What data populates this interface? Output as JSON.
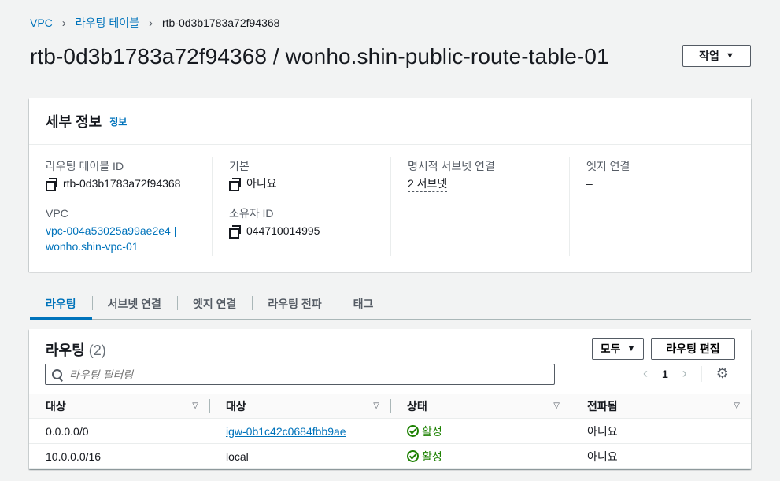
{
  "breadcrumb": {
    "items": [
      "VPC",
      "라우팅 테이블"
    ],
    "current": "rtb-0d3b1783a72f94368"
  },
  "page": {
    "title": "rtb-0d3b1783a72f94368 / wonho.shin-public-route-table-01",
    "action_label": "작업"
  },
  "details": {
    "heading": "세부 정보",
    "info_link": "정보",
    "route_table_id_label": "라우팅 테이블 ID",
    "route_table_id": "rtb-0d3b1783a72f94368",
    "vpc_label": "VPC",
    "vpc_value_1": "vpc-004a53025a99ae2e4 |",
    "vpc_value_2": "wonho.shin-vpc-01",
    "main_label": "기본",
    "main_value": "아니요",
    "owner_label": "소유자 ID",
    "owner_value": "044710014995",
    "explicit_subnet_label": "명시적 서브넷 연결",
    "explicit_subnet_value": "2 서브넷",
    "edge_label": "엣지 연결",
    "edge_value": "–"
  },
  "tabs": [
    "라우팅",
    "서브넷 연결",
    "엣지 연결",
    "라우팅 전파",
    "태그"
  ],
  "routes": {
    "heading": "라우팅",
    "count": "(2)",
    "filter_select": "모두",
    "edit_button": "라우팅 편집",
    "search_placeholder": "라우팅 필터링",
    "page_number": "1",
    "columns": [
      "대상",
      "대상",
      "상태",
      "전파됨"
    ],
    "rows": [
      {
        "destination": "0.0.0.0/0",
        "target": "igw-0b1c42c0684fbb9ae",
        "status": "활성",
        "propagated": "아니요"
      },
      {
        "destination": "10.0.0.0/16",
        "target": "local",
        "status": "활성",
        "propagated": "아니요"
      }
    ]
  },
  "colors": {
    "link": "#0073bb",
    "success": "#1d8102",
    "background": "#f2f3f3"
  }
}
